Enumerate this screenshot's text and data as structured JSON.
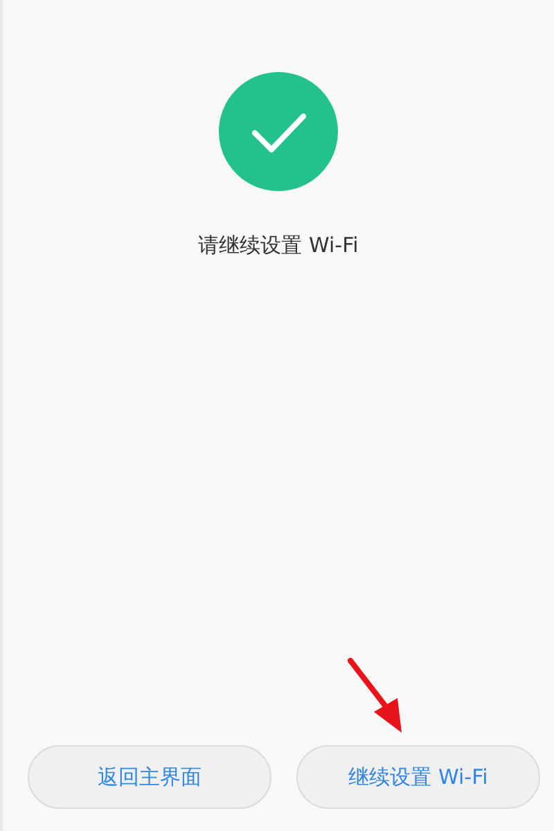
{
  "status": {
    "message": "请继续设置 Wi-Fi"
  },
  "buttons": [
    {
      "label": "返回主界面"
    },
    {
      "label": "继续设置 Wi-Fi"
    }
  ]
}
